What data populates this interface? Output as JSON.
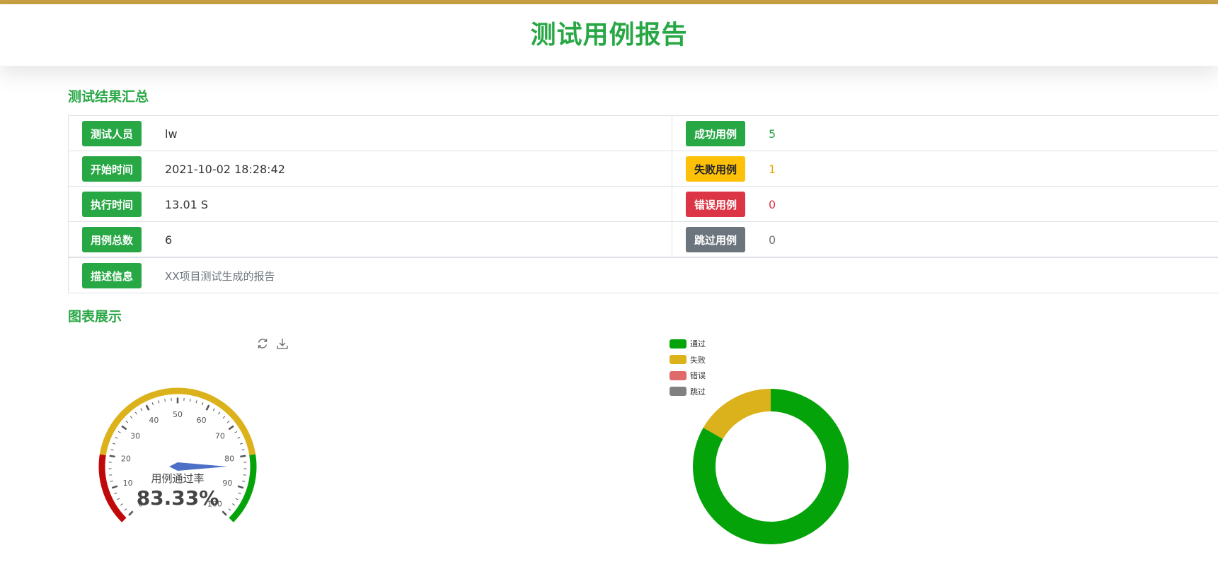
{
  "header": {
    "title": "测试用例报告"
  },
  "summary": {
    "title": "测试结果汇总",
    "rows": [
      {
        "left": {
          "label": "测试人员",
          "value": "lw"
        },
        "right": {
          "label": "成功用例",
          "value": "5"
        }
      },
      {
        "left": {
          "label": "开始时间",
          "value": "2021-10-02 18:28:42"
        },
        "right": {
          "label": "失败用例",
          "value": "1"
        }
      },
      {
        "left": {
          "label": "执行时间",
          "value": "13.01 S"
        },
        "right": {
          "label": "错误用例",
          "value": "0"
        }
      },
      {
        "left": {
          "label": "用例总数",
          "value": "6"
        },
        "right": {
          "label": "跳过用例",
          "value": "0"
        }
      }
    ],
    "description": {
      "label": "描述信息",
      "value": "XX项目测试生成的报告"
    }
  },
  "charts": {
    "title": "图表展示",
    "toolbox": [
      "refresh-icon",
      "download-icon"
    ]
  },
  "colors": {
    "pass": "#05a30a",
    "fail": "#dcb21c",
    "error": "#e06a6a",
    "skip": "#808080",
    "gauge_low": "#c00a0a",
    "needle": "#4e6fc6",
    "brand": "#28a745",
    "topbar": "#c9a043"
  },
  "chart_data": [
    {
      "type": "gauge",
      "name": "用例通过率",
      "value": 83.33,
      "value_label": "83.33%",
      "min": 0,
      "max": 100,
      "tick_labels": [
        "0",
        "10",
        "20",
        "30",
        "40",
        "50",
        "60",
        "70",
        "80",
        "90",
        "100"
      ],
      "bands": [
        {
          "to": 0.2,
          "color": "#c00a0a"
        },
        {
          "to": 0.8,
          "color": "#dcb21c"
        },
        {
          "to": 1.0,
          "color": "#05a30a"
        }
      ]
    },
    {
      "type": "pie",
      "donut": true,
      "legend_position": "top-left",
      "categories": [
        "通过",
        "失败",
        "错误",
        "跳过"
      ],
      "values": [
        5,
        1,
        0,
        0
      ],
      "colors": [
        "#05a30a",
        "#dcb21c",
        "#e06a6a",
        "#808080"
      ]
    }
  ]
}
